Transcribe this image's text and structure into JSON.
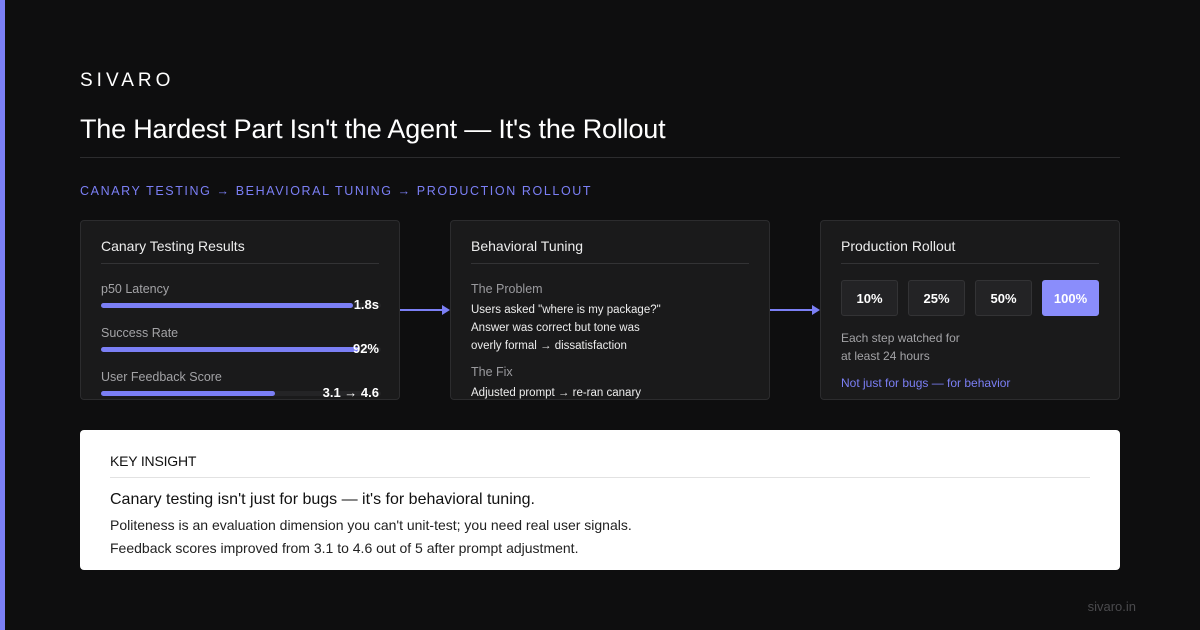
{
  "brand": "SIVARO",
  "title": "The Hardest Part Isn't the Agent — It's the Rollout",
  "subtitle": "CANARY TESTING → BEHAVIORAL TUNING → PRODUCTION ROLLOUT",
  "colors": {
    "accent": "#7b7ff5",
    "background": "#0e0e0f",
    "card": "#1a1a1b",
    "insight_bg": "#ffffff"
  },
  "canary": {
    "title": "Canary Testing Results",
    "metrics": [
      {
        "label": "p50 Latency",
        "value": "1.8s",
        "fill": 0.9
      },
      {
        "label": "Success Rate",
        "value": "92%",
        "fill": 0.92
      },
      {
        "label": "User Feedback Score",
        "value": "3.1 → 4.6",
        "fill": 0.62
      }
    ]
  },
  "tuning": {
    "title": "Behavioral Tuning",
    "problem_label": "The Problem",
    "problem_lines": [
      "Users asked \"where is my package?\"",
      "Answer was correct but tone was",
      "overly formal → dissatisfaction"
    ],
    "fix_label": "The Fix",
    "fix_lines": [
      "Adjusted prompt → re-ran canary"
    ]
  },
  "rollout": {
    "title": "Production Rollout",
    "steps": [
      "10%",
      "25%",
      "50%",
      "100%"
    ],
    "active_step": 3,
    "note_lines": [
      "Each step watched for",
      "at least 24 hours"
    ],
    "tagline": "Not just for bugs — for behavior"
  },
  "insight": {
    "heading": "KEY INSIGHT",
    "main": "Canary testing isn't just for bugs — it's for behavioral tuning.",
    "lines": [
      "Politeness is an evaluation dimension you can't unit-test; you need real user signals.",
      "Feedback scores improved from 3.1 to 4.6 out of 5 after prompt adjustment."
    ]
  },
  "footer": "sivaro.in"
}
